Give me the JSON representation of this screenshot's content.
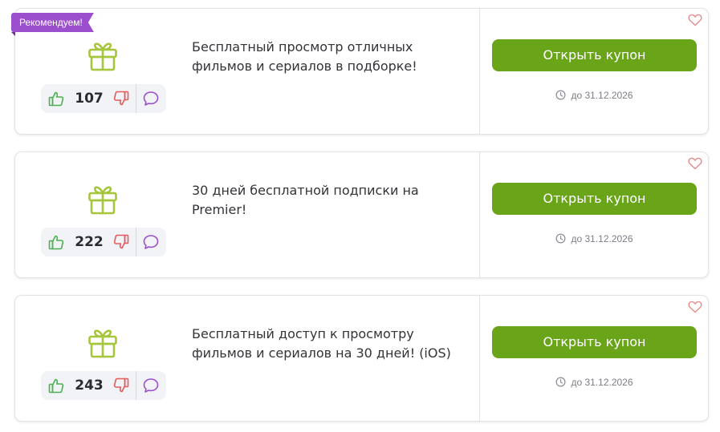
{
  "coupons": [
    {
      "badge": "Рекомендуем!",
      "votes": "107",
      "title": "Бесплатный просмотр отличных фильмов и сериалов в подборке!",
      "button_label": "Открыть купон",
      "expiry": "до 31.12.2026"
    },
    {
      "votes": "222",
      "title": "30 дней бесплатной подписки на Premier!",
      "button_label": "Открыть купон",
      "expiry": "до 31.12.2026"
    },
    {
      "votes": "243",
      "title": "Бесплатный доступ к просмотру фильмов и сериалов на 30 дней! (iOS)",
      "button_label": "Открыть купон",
      "expiry": "до 31.12.2026"
    }
  ],
  "icons": {
    "gift": "gift-icon",
    "vote_up": "thumbs-up-icon",
    "vote_down": "thumbs-down-icon",
    "comment": "comment-icon",
    "expiry": "clock-icon",
    "favorite": "heart-icon"
  },
  "colors": {
    "accent_green": "#6aa519",
    "gift_green": "#a5c63b",
    "badge_purple": "#9c4fcd",
    "vote_up_green": "#4caf50",
    "vote_down_red": "#e35a5a",
    "comment_purple": "#9c4fcd",
    "heart_red": "#e88a8a"
  }
}
